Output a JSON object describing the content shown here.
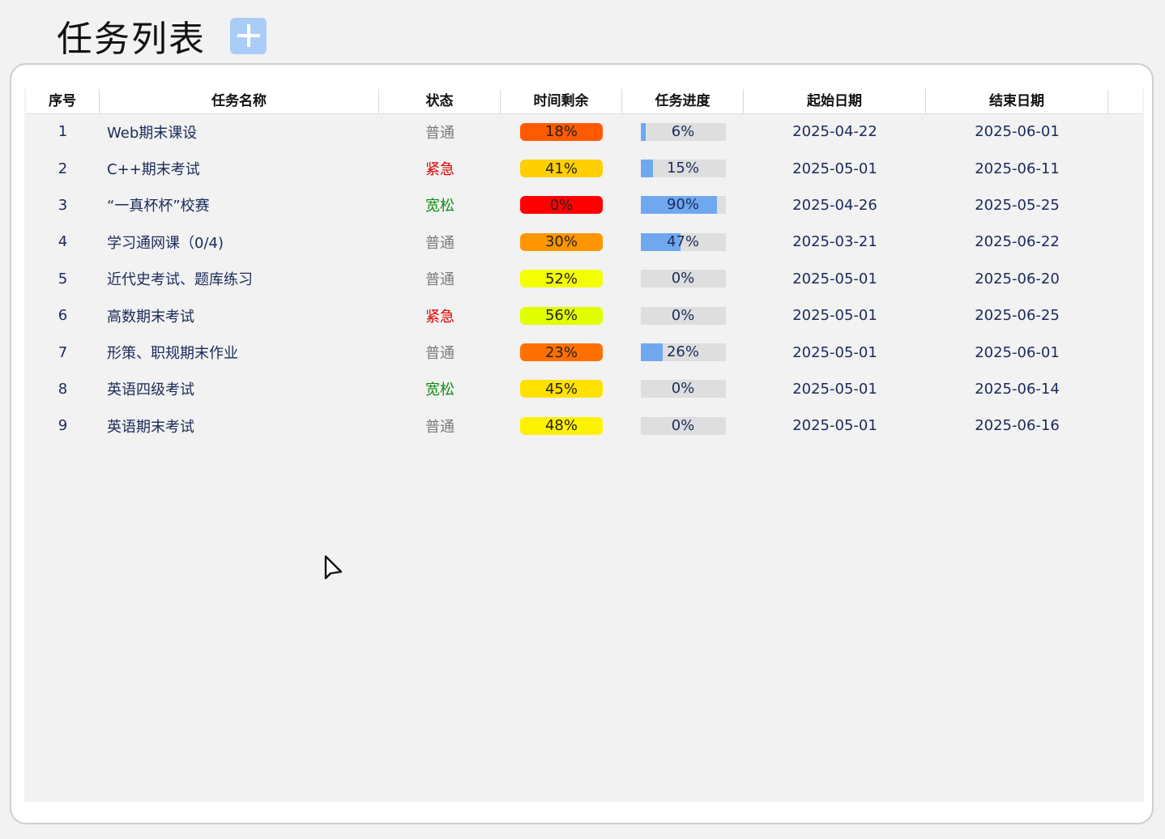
{
  "header": {
    "title": "任务列表",
    "add_icon": "plus-icon",
    "add_button_color": "#a9cdf6"
  },
  "table": {
    "columns": [
      "序号",
      "任务名称",
      "状态",
      "时间剩余",
      "任务进度",
      "起始日期",
      "结束日期"
    ],
    "rows": [
      {
        "id": "1",
        "name": "Web期末课设",
        "status": "普通",
        "status_type": "normal",
        "time_left": "18%",
        "time_color": "#ff5a00",
        "progress": "6%",
        "progress_value": 6,
        "start": "2025-04-22",
        "end": "2025-06-01"
      },
      {
        "id": "2",
        "name": "C++期末考试",
        "status": "紧急",
        "status_type": "urgent",
        "time_left": "41%",
        "time_color": "#ffcf00",
        "progress": "15%",
        "progress_value": 15,
        "start": "2025-05-01",
        "end": "2025-06-11"
      },
      {
        "id": "3",
        "name": "“一真杯杯”校赛",
        "status": "宽松",
        "status_type": "loose",
        "time_left": "0%",
        "time_color": "#ff0000",
        "progress": "90%",
        "progress_value": 90,
        "start": "2025-04-26",
        "end": "2025-05-25"
      },
      {
        "id": "4",
        "name": "学习通网课（0/4)",
        "status": "普通",
        "status_type": "normal",
        "time_left": "30%",
        "time_color": "#ff9600",
        "progress": "47%",
        "progress_value": 47,
        "start": "2025-03-21",
        "end": "2025-06-22"
      },
      {
        "id": "5",
        "name": "近代史考试、题库练习",
        "status": "普通",
        "status_type": "normal",
        "time_left": "52%",
        "time_color": "#f4ff00",
        "progress": "0%",
        "progress_value": 0,
        "start": "2025-05-01",
        "end": "2025-06-20"
      },
      {
        "id": "6",
        "name": "高数期末考试",
        "status": "紧急",
        "status_type": "urgent",
        "time_left": "56%",
        "time_color": "#e0ff00",
        "progress": "0%",
        "progress_value": 0,
        "start": "2025-05-01",
        "end": "2025-06-25"
      },
      {
        "id": "7",
        "name": "形策、职规期末作业",
        "status": "普通",
        "status_type": "normal",
        "time_left": "23%",
        "time_color": "#ff7000",
        "progress": "26%",
        "progress_value": 26,
        "start": "2025-05-01",
        "end": "2025-06-01"
      },
      {
        "id": "8",
        "name": "英语四级考试",
        "status": "宽松",
        "status_type": "loose",
        "time_left": "45%",
        "time_color": "#ffe100",
        "progress": "0%",
        "progress_value": 0,
        "start": "2025-05-01",
        "end": "2025-06-14"
      },
      {
        "id": "9",
        "name": "英语期末考试",
        "status": "普通",
        "status_type": "normal",
        "time_left": "48%",
        "time_color": "#fff200",
        "progress": "0%",
        "progress_value": 0,
        "start": "2025-05-01",
        "end": "2025-06-16"
      }
    ]
  },
  "progress_fill_color": "#6fa8ef",
  "cursor_icon": "mouse-pointer-icon"
}
